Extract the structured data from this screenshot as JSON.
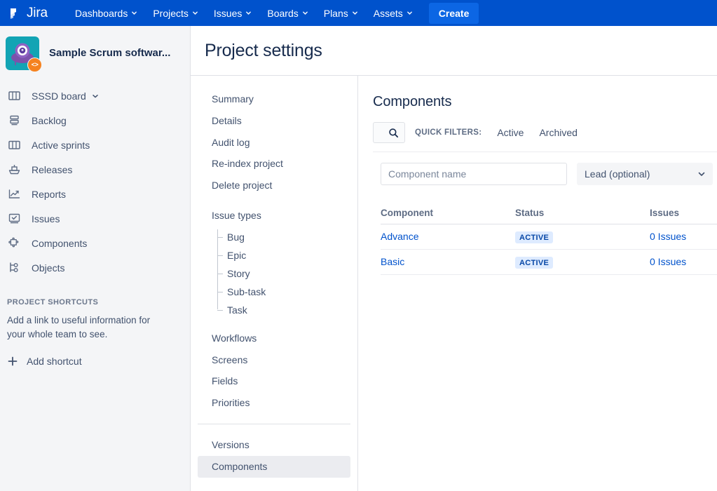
{
  "topnav": {
    "brand": "Jira",
    "items": [
      {
        "label": "Dashboards",
        "has_caret": true
      },
      {
        "label": "Projects",
        "has_caret": true
      },
      {
        "label": "Issues",
        "has_caret": true
      },
      {
        "label": "Boards",
        "has_caret": true
      },
      {
        "label": "Plans",
        "has_caret": true
      },
      {
        "label": "Assets",
        "has_caret": true
      }
    ],
    "create_label": "Create"
  },
  "sidebar": {
    "project_name": "Sample Scrum softwar...",
    "avatar_badge": "<>",
    "items": [
      {
        "label": "SSSD board",
        "icon": "board-icon",
        "caret": true
      },
      {
        "label": "Backlog",
        "icon": "backlog-icon",
        "caret": false
      },
      {
        "label": "Active sprints",
        "icon": "sprints-icon",
        "caret": false
      },
      {
        "label": "Releases",
        "icon": "releases-icon",
        "caret": false
      },
      {
        "label": "Reports",
        "icon": "reports-icon",
        "caret": false
      },
      {
        "label": "Issues",
        "icon": "issues-icon",
        "caret": false
      },
      {
        "label": "Components",
        "icon": "components-icon",
        "caret": false
      },
      {
        "label": "Objects",
        "icon": "objects-icon",
        "caret": false
      }
    ],
    "shortcuts": {
      "title": "PROJECT SHORTCUTS",
      "description": "Add a link to useful information for your whole team to see.",
      "add_label": "Add shortcut"
    }
  },
  "page": {
    "title": "Project settings"
  },
  "settings_nav": {
    "group1": [
      "Summary",
      "Details",
      "Audit log",
      "Re-index project",
      "Delete project"
    ],
    "issue_types_label": "Issue types",
    "issue_types": [
      "Bug",
      "Epic",
      "Story",
      "Sub-task",
      "Task"
    ],
    "group2": [
      "Workflows",
      "Screens",
      "Fields",
      "Priorities"
    ],
    "group3": [
      "Versions",
      "Components"
    ],
    "selected": "Components"
  },
  "main": {
    "heading": "Components",
    "quick_filters_label": "QUICK FILTERS:",
    "quick_filters": [
      "Active",
      "Archived"
    ],
    "form": {
      "component_name_placeholder": "Component name",
      "component_name_value": "",
      "lead_selected": "Lead (optional)"
    },
    "table": {
      "columns": [
        "Component",
        "Status",
        "Issues"
      ],
      "rows": [
        {
          "component": "Advance",
          "status": "ACTIVE",
          "issues": "0 Issues"
        },
        {
          "component": "Basic",
          "status": "ACTIVE",
          "issues": "0 Issues"
        }
      ]
    }
  },
  "colors": {
    "nav_blue": "#0052CC",
    "create_blue": "#0C66E4",
    "link_blue": "#0052CC",
    "badge_bg": "#DEEBFF",
    "badge_text": "#0747A6",
    "sidebar_bg": "#F4F5F7",
    "avatar_bg": "#12A4B4",
    "avatar_badge_bg": "#F58220"
  }
}
